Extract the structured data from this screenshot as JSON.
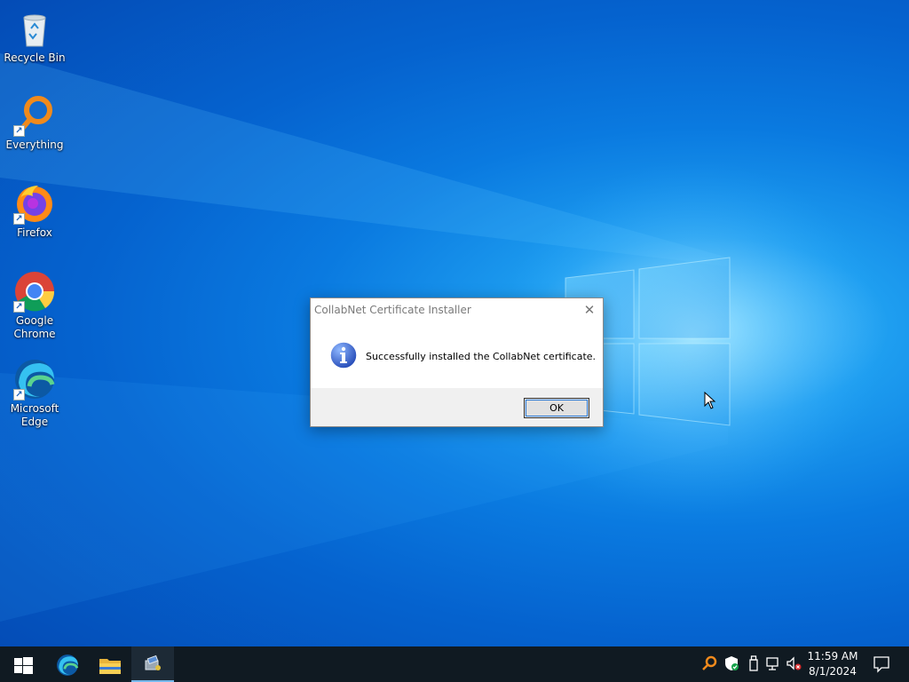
{
  "desktop": {
    "icons": [
      {
        "label": "Recycle Bin",
        "icon": "recycle-bin-icon",
        "shortcut": false
      },
      {
        "label": "Everything",
        "icon": "everything-search-icon",
        "shortcut": true
      },
      {
        "label": "Firefox",
        "icon": "firefox-icon",
        "shortcut": true
      },
      {
        "label": "Google Chrome",
        "icon": "chrome-icon",
        "shortcut": true
      },
      {
        "label": "Microsoft Edge",
        "icon": "edge-icon",
        "shortcut": true
      }
    ]
  },
  "dialog": {
    "title": "CollabNet Certificate Installer",
    "close_glyph": "✕",
    "icon": "info-icon",
    "message": "Successfully installed the CollabNet certificate.",
    "ok_label": "OK"
  },
  "taskbar": {
    "pinned": [
      "start-icon",
      "edge-icon",
      "file-explorer-icon",
      "installer-app-icon"
    ],
    "tray": [
      "everything-search-icon",
      "windows-security-icon",
      "usb-drive-icon",
      "network-icon",
      "volume-muted-icon"
    ],
    "clock": {
      "time": "11:59 AM",
      "date": "8/1/2024"
    }
  },
  "colors": {
    "taskbar": "#101a22",
    "accent": "#76b9ed",
    "desktop": "#0a7ae0"
  }
}
